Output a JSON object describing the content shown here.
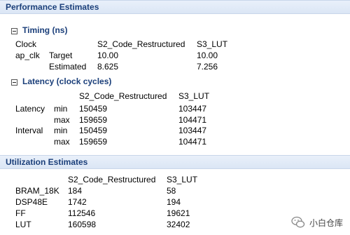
{
  "performance": {
    "title": "Performance Estimates",
    "timing": {
      "title": "Timing (ns)",
      "col_clock": "Clock",
      "col_a": "S2_Code_Restructured",
      "col_b": "S3_LUT",
      "rows": [
        {
          "clock": "ap_clk",
          "label": "Target",
          "a": "10.00",
          "b": "10.00"
        },
        {
          "clock": "",
          "label": "Estimated",
          "a": "8.625",
          "b": "7.256"
        }
      ]
    },
    "latency": {
      "title": "Latency (clock cycles)",
      "col_a": "S2_Code_Restructured",
      "col_b": "S3_LUT",
      "rows": [
        {
          "group": "Latency",
          "label": "min",
          "a": "150459",
          "b": "103447"
        },
        {
          "group": "",
          "label": "max",
          "a": "159659",
          "b": "104471"
        },
        {
          "group": "Interval",
          "label": "min",
          "a": "150459",
          "b": "103447"
        },
        {
          "group": "",
          "label": "max",
          "a": "159659",
          "b": "104471"
        }
      ]
    }
  },
  "utilization": {
    "title": "Utilization Estimates",
    "col_a": "S2_Code_Restructured",
    "col_b": "S3_LUT",
    "rows": [
      {
        "label": "BRAM_18K",
        "a": "184",
        "b": "58"
      },
      {
        "label": "DSP48E",
        "a": "1742",
        "b": "194"
      },
      {
        "label": "FF",
        "a": "112546",
        "b": "19621"
      },
      {
        "label": "LUT",
        "a": "160598",
        "b": "32402"
      }
    ]
  },
  "watermark": {
    "text": "小白仓库",
    "icon": "wechat-icon"
  }
}
